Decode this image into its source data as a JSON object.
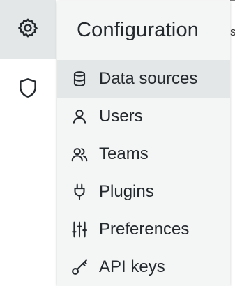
{
  "sidemenu": {
    "items": [
      {
        "icon": "gear-icon",
        "active": true
      },
      {
        "icon": "shield-icon",
        "active": false
      }
    ]
  },
  "background": {
    "partial_text": "s"
  },
  "dropdown": {
    "header": "Configuration",
    "items": [
      {
        "label": "Data sources",
        "icon": "database-icon",
        "active": true
      },
      {
        "label": "Users",
        "icon": "user-icon",
        "active": false
      },
      {
        "label": "Teams",
        "icon": "users-icon",
        "active": false
      },
      {
        "label": "Plugins",
        "icon": "plug-icon",
        "active": false
      },
      {
        "label": "Preferences",
        "icon": "sliders-icon",
        "active": false
      },
      {
        "label": "API keys",
        "icon": "key-icon",
        "active": false
      }
    ]
  },
  "colors": {
    "active_bg": "#e4e7e7",
    "menu_bg": "#f4f5f5",
    "text": "#24292e"
  }
}
